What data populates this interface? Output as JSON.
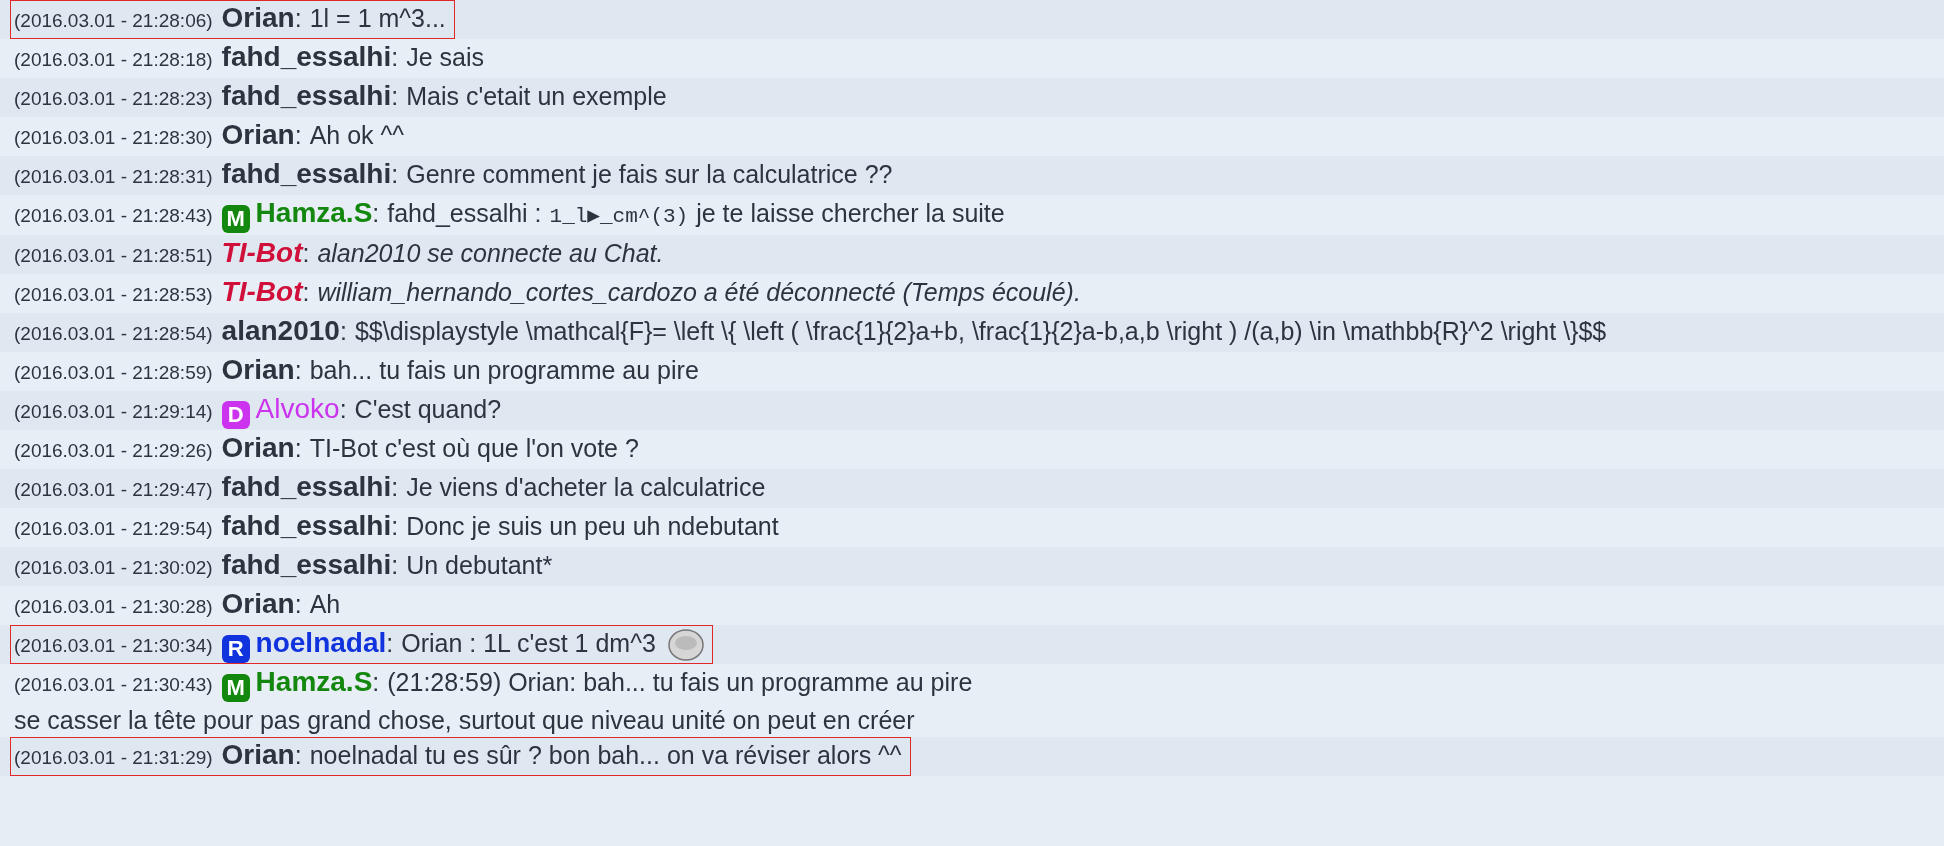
{
  "messages": [
    {
      "time": "(2016.03.01 - 21:28:06)",
      "user": "Orian",
      "kind": "member",
      "separator": ":",
      "highlighted": true,
      "message": "1l = 1 m^3..."
    },
    {
      "time": "(2016.03.01 - 21:28:18)",
      "user": "fahd_essalhi",
      "kind": "member",
      "separator": ":",
      "highlighted": false,
      "message": "Je sais"
    },
    {
      "time": "(2016.03.01 - 21:28:23)",
      "user": "fahd_essalhi",
      "kind": "member",
      "separator": ":",
      "highlighted": false,
      "message": "Mais c'etait un exemple"
    },
    {
      "time": "(2016.03.01 - 21:28:30)",
      "user": "Orian",
      "kind": "member",
      "separator": ":",
      "highlighted": false,
      "message": "Ah ok ^^"
    },
    {
      "time": "(2016.03.01 - 21:28:31)",
      "user": "fahd_essalhi",
      "kind": "member",
      "separator": ":",
      "highlighted": false,
      "message": "Genre comment je fais sur la calculatrice ??"
    },
    {
      "time": "(2016.03.01 - 21:28:43)",
      "user": "Hamza.S",
      "kind": "badged",
      "badge": "M",
      "color": "#14870f",
      "bold": true,
      "separator": ":",
      "highlighted": false,
      "segments": [
        {
          "kind": "plain",
          "text": "fahd_essalhi :"
        },
        {
          "kind": "code",
          "text": "1_l▶_cm^(3)"
        },
        {
          "kind": "plain",
          "text": "je te laisse chercher la suite"
        }
      ]
    },
    {
      "time": "(2016.03.01 - 21:28:51)",
      "user": "TI-Bot",
      "kind": "bot",
      "separator": ":",
      "highlighted": false,
      "message": "alan2010 se connecte au Chat."
    },
    {
      "time": "(2016.03.01 - 21:28:53)",
      "user": "TI-Bot",
      "kind": "bot",
      "separator": ":",
      "highlighted": false,
      "message": "william_hernando_cortes_cardozo a été déconnecté (Temps écoulé)."
    },
    {
      "time": "(2016.03.01 - 21:28:54)",
      "user": "alan2010",
      "kind": "member",
      "separator": ":",
      "highlighted": false,
      "message": "$$\\displaystyle \\mathcal{F}= \\left \\{ \\left ( \\frac{1}{2}a+b, \\frac{1}{2}a-b,a,b \\right ) /(a,b) \\in \\mathbb{R}^2 \\right \\}$$"
    },
    {
      "time": "(2016.03.01 - 21:28:59)",
      "user": "Orian",
      "kind": "member",
      "separator": ":",
      "highlighted": false,
      "message": "bah... tu fais un programme au pire"
    },
    {
      "time": "(2016.03.01 - 21:29:14)",
      "user": "Alvoko",
      "kind": "badged",
      "badge": "D",
      "color": "#cc33ee",
      "bold": false,
      "separator": ":",
      "highlighted": false,
      "message": "C'est quand?"
    },
    {
      "time": "(2016.03.01 - 21:29:26)",
      "user": "Orian",
      "kind": "member",
      "separator": ":",
      "highlighted": false,
      "message": "TI-Bot c'est où que l'on vote ?"
    },
    {
      "time": "(2016.03.01 - 21:29:47)",
      "user": "fahd_essalhi",
      "kind": "member",
      "separator": ":",
      "highlighted": false,
      "message": "Je viens d'acheter la calculatrice"
    },
    {
      "time": "(2016.03.01 - 21:29:54)",
      "user": "fahd_essalhi",
      "kind": "member",
      "separator": ":",
      "highlighted": false,
      "message": "Donc je suis un peu uh ndebutant"
    },
    {
      "time": "(2016.03.01 - 21:30:02)",
      "user": "fahd_essalhi",
      "kind": "member",
      "separator": ":",
      "highlighted": false,
      "message": "Un debutant*"
    },
    {
      "time": "(2016.03.01 - 21:30:28)",
      "user": "Orian",
      "kind": "member",
      "separator": ":",
      "highlighted": false,
      "message": "Ah"
    },
    {
      "time": "(2016.03.01 - 21:30:34)",
      "user": "noelnadal",
      "kind": "badged",
      "badge": "R",
      "color": "#1133dd",
      "bold": true,
      "separator": ":",
      "highlighted": true,
      "message": "Orian : 1L c'est 1 dm^3",
      "emoticon": true
    },
    {
      "time": "(2016.03.01 - 21:30:43)",
      "user": "Hamza.S",
      "kind": "badged",
      "badge": "M",
      "color": "#14870f",
      "bold": true,
      "separator": ":",
      "highlighted": false,
      "message": "(21:28:59) Orian: bah... tu fais un programme au pire",
      "continuation": "se casser la tête pour pas grand chose, surtout que niveau unité on peut en créer"
    },
    {
      "time": "(2016.03.01 - 21:31:29)",
      "user": "Orian",
      "kind": "member",
      "separator": ":",
      "highlighted": true,
      "message": "noelnadal tu es sûr ? bon bah... on va réviser alors ^^"
    }
  ]
}
